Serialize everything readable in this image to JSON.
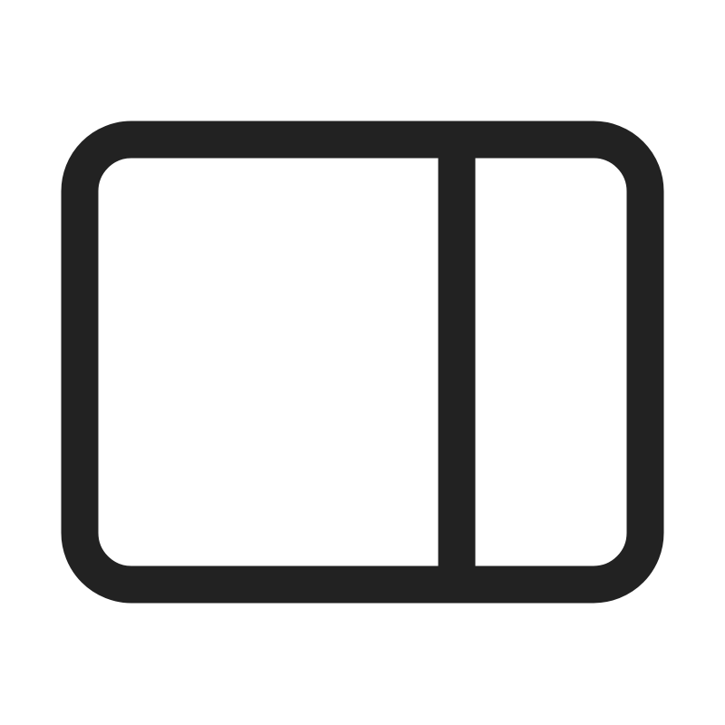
{
  "icon": {
    "name": "panel-right-icon",
    "stroke_color": "#222222",
    "background_color": "#ffffff"
  }
}
